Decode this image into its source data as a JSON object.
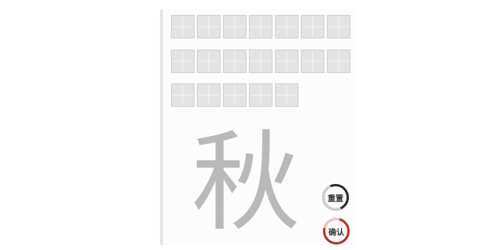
{
  "writing_grid": {
    "rows": [
      {
        "count": 7
      },
      {
        "count": 7
      },
      {
        "count": 5
      }
    ]
  },
  "practice": {
    "character": "秋"
  },
  "controls": {
    "reset_label": "重置",
    "confirm_label": "确认",
    "reset_color": "#2c2c2c",
    "confirm_color": "#b9302e"
  }
}
